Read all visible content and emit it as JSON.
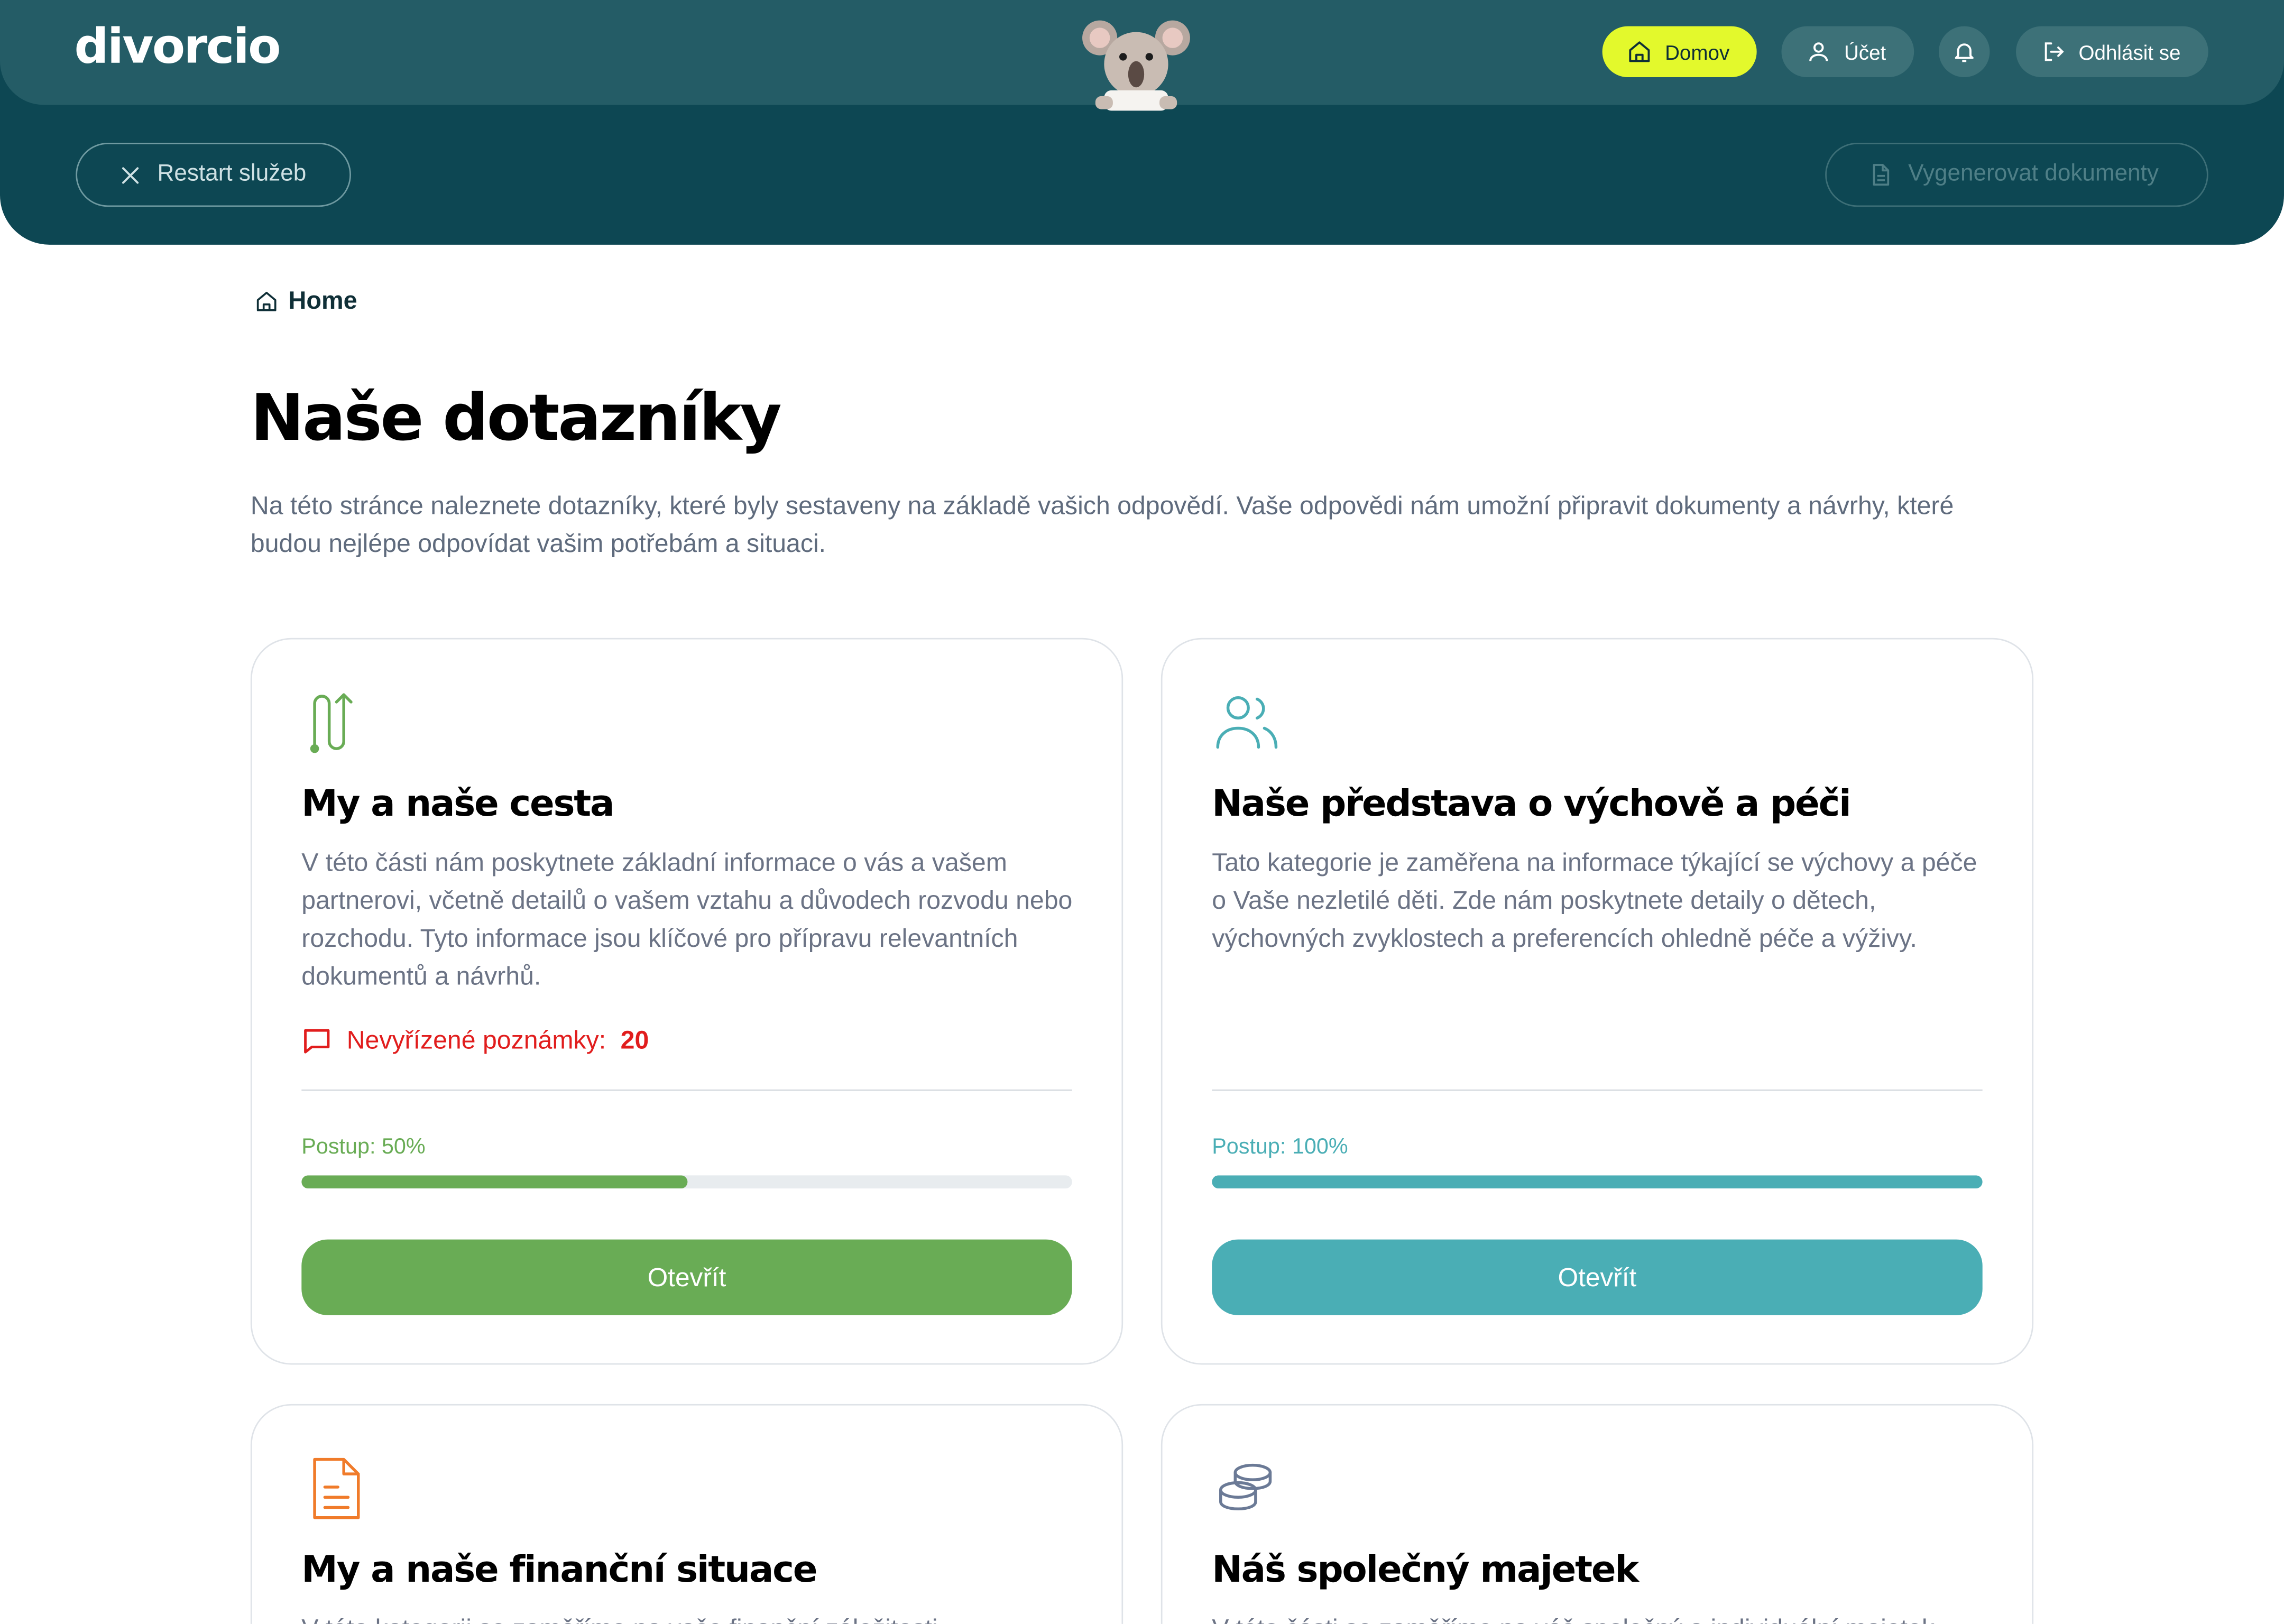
{
  "header": {
    "logo": "divorcio",
    "nav": {
      "home_label": "Domov",
      "account_label": "Účet",
      "logout_label": "Odhlásit se"
    },
    "restart_label": "Restart služeb",
    "generate_label": "Vygenerovat dokumenty"
  },
  "breadcrumb": {
    "label": "Home"
  },
  "page": {
    "title": "Naše dotazníky",
    "intro": "Na této stránce naleznete dotazníky, které byly sestaveny na základě vašich odpovědí. Vaše odpovědi nám umožní připravit dokumenty a návrhy, které budou nejlépe odpovídat vašim potřebám a situaci."
  },
  "cards": [
    {
      "icon": "route-icon",
      "title": "My a naše cesta",
      "description": "V této části nám poskytnete základní informace o vás a vašem partnerovi, včetně detailů o vašem vztahu a důvodech rozvodu nebo rozchodu. Tyto informace jsou klíčové pro přípravu relevantních dokumentů a návrhů.",
      "notes_label": "Nevyřízené poznámky:",
      "notes_count": "20",
      "progress_label": "Postup: 50%",
      "progress": 0.5,
      "button_label": "Otevřít",
      "color": "#69ac55"
    },
    {
      "icon": "users-icon",
      "title": "Naše představa o výchově a péči",
      "description": "Tato kategorie je zaměřena na informace týkající se výchovy a péče o Vaše nezletilé děti. Zde nám poskytnete detaily o dětech, výchovných zvyklostech a preferencích ohledně péče a výživy.",
      "progress_label": "Postup: 100%",
      "progress": 1.0,
      "button_label": "Otevřít",
      "color": "#4aaeb5"
    },
    {
      "icon": "document-icon",
      "title": "My a naše finanční situace",
      "description": "V této kategorii se zaměříme na vaše finanční záležitosti",
      "color": "#f07b2a"
    },
    {
      "icon": "coins-icon",
      "title": "Náš společný majetek",
      "description": "V této části se zaměříme na váš společný a individuální majetek",
      "color": "#6b7a96"
    }
  ],
  "colors": {
    "header_dark": "#0d4753",
    "header_light": "#245c66",
    "accent_yellow": "#e3f92c",
    "notes_red": "#e11d1d"
  }
}
